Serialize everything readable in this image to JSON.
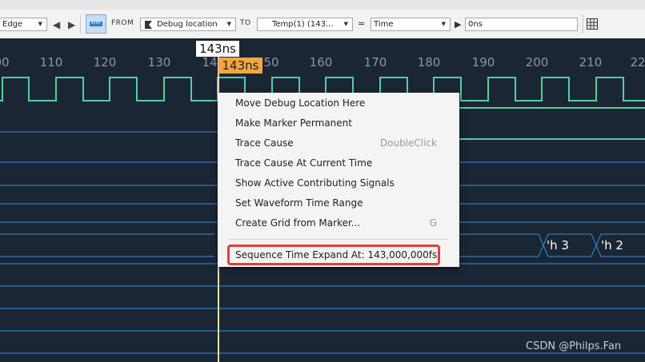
{
  "toolbar": {
    "edge_dropdown": "Edge",
    "from_label": "FROM",
    "from_dropdown": "Debug location",
    "to_label": "TO",
    "to_dropdown": "Temp(1) (143...",
    "equals_label": "=",
    "mode_dropdown": "Time",
    "time_input_value": "0ns"
  },
  "ruler": {
    "ticks": [
      "00",
      "110",
      "120",
      "130",
      "14",
      "50",
      "160",
      "170",
      "180",
      "190",
      "200",
      "210",
      "22"
    ]
  },
  "cursor": {
    "white_label": "143ns",
    "orange_label": "143ns"
  },
  "bus_values": [
    "'h 3",
    "'h 2"
  ],
  "context_menu": {
    "items": [
      {
        "label": "Move Debug Location Here",
        "shortcut": ""
      },
      {
        "label": "Make Marker Permanent",
        "shortcut": ""
      },
      {
        "label": "Trace Cause",
        "shortcut": "DoubleClick"
      },
      {
        "label": "Trace Cause At Current Time",
        "shortcut": ""
      },
      {
        "label": "Show Active Contributing Signals",
        "shortcut": ""
      },
      {
        "label": "Set Waveform Time Range",
        "shortcut": ""
      },
      {
        "label": "Create Grid from Marker...",
        "shortcut": "G"
      }
    ],
    "highlighted_item": "Sequence Time Expand At: 143,000,000fs"
  },
  "watermark": "CSDN @Philps.Fan",
  "colors": {
    "background": "#1b2634",
    "clock_wave": "#4fd1a1",
    "signal_line": "#2f8fe0",
    "cursor_orange": "#f4a646",
    "highlight_border": "#e0403a"
  }
}
